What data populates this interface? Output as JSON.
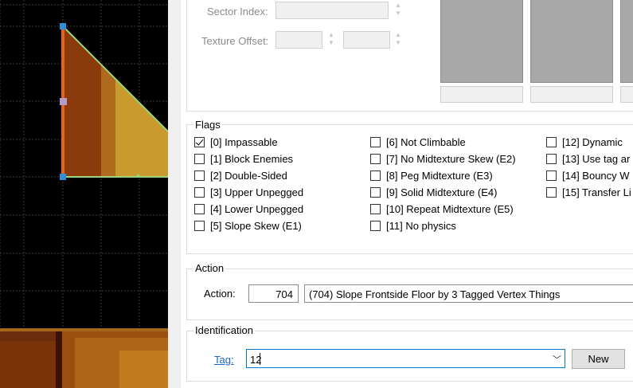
{
  "sector": {
    "sector_index_label": "Sector Index:",
    "texture_offset_label": "Texture Offset:"
  },
  "flags": {
    "title": "Flags",
    "items": [
      {
        "label": "[0] Impassable",
        "checked": true
      },
      {
        "label": "[1] Block Enemies",
        "checked": false
      },
      {
        "label": "[2] Double-Sided",
        "checked": false
      },
      {
        "label": "[3] Upper Unpegged",
        "checked": false
      },
      {
        "label": "[4] Lower Unpegged",
        "checked": false
      },
      {
        "label": "[5] Slope Skew (E1)",
        "checked": false
      },
      {
        "label": "[6] Not Climbable",
        "checked": false
      },
      {
        "label": "[7] No Midtexture Skew (E2)",
        "checked": false
      },
      {
        "label": "[8] Peg Midtexture (E3)",
        "checked": false
      },
      {
        "label": "[9] Solid Midtexture (E4)",
        "checked": false
      },
      {
        "label": "[10] Repeat Midtexture (E5)",
        "checked": false
      },
      {
        "label": "[11] No physics",
        "checked": false
      },
      {
        "label": "[12] Dynamic",
        "checked": false
      },
      {
        "label": "[13] Use tag ar",
        "checked": false
      },
      {
        "label": "[14] Bouncy W",
        "checked": false
      },
      {
        "label": "[15] Transfer Li",
        "checked": false
      }
    ]
  },
  "action": {
    "title": "Action",
    "label": "Action:",
    "number": "704",
    "description": "(704) Slope Frontside Floor by 3 Tagged Vertex Things"
  },
  "identification": {
    "title": "Identification",
    "tag_label": "Tag:",
    "tag_value": "12",
    "new_button": "New"
  },
  "colors": {
    "viewport_bg": "#000000",
    "sector_fill": "#8b3a0c",
    "sector_highlight": "#c99a2e",
    "linedef_selected": "#e8621a",
    "linedef_normal": "#9ad67a",
    "vertex": "#2f8fd8",
    "link": "#1a66c9"
  }
}
